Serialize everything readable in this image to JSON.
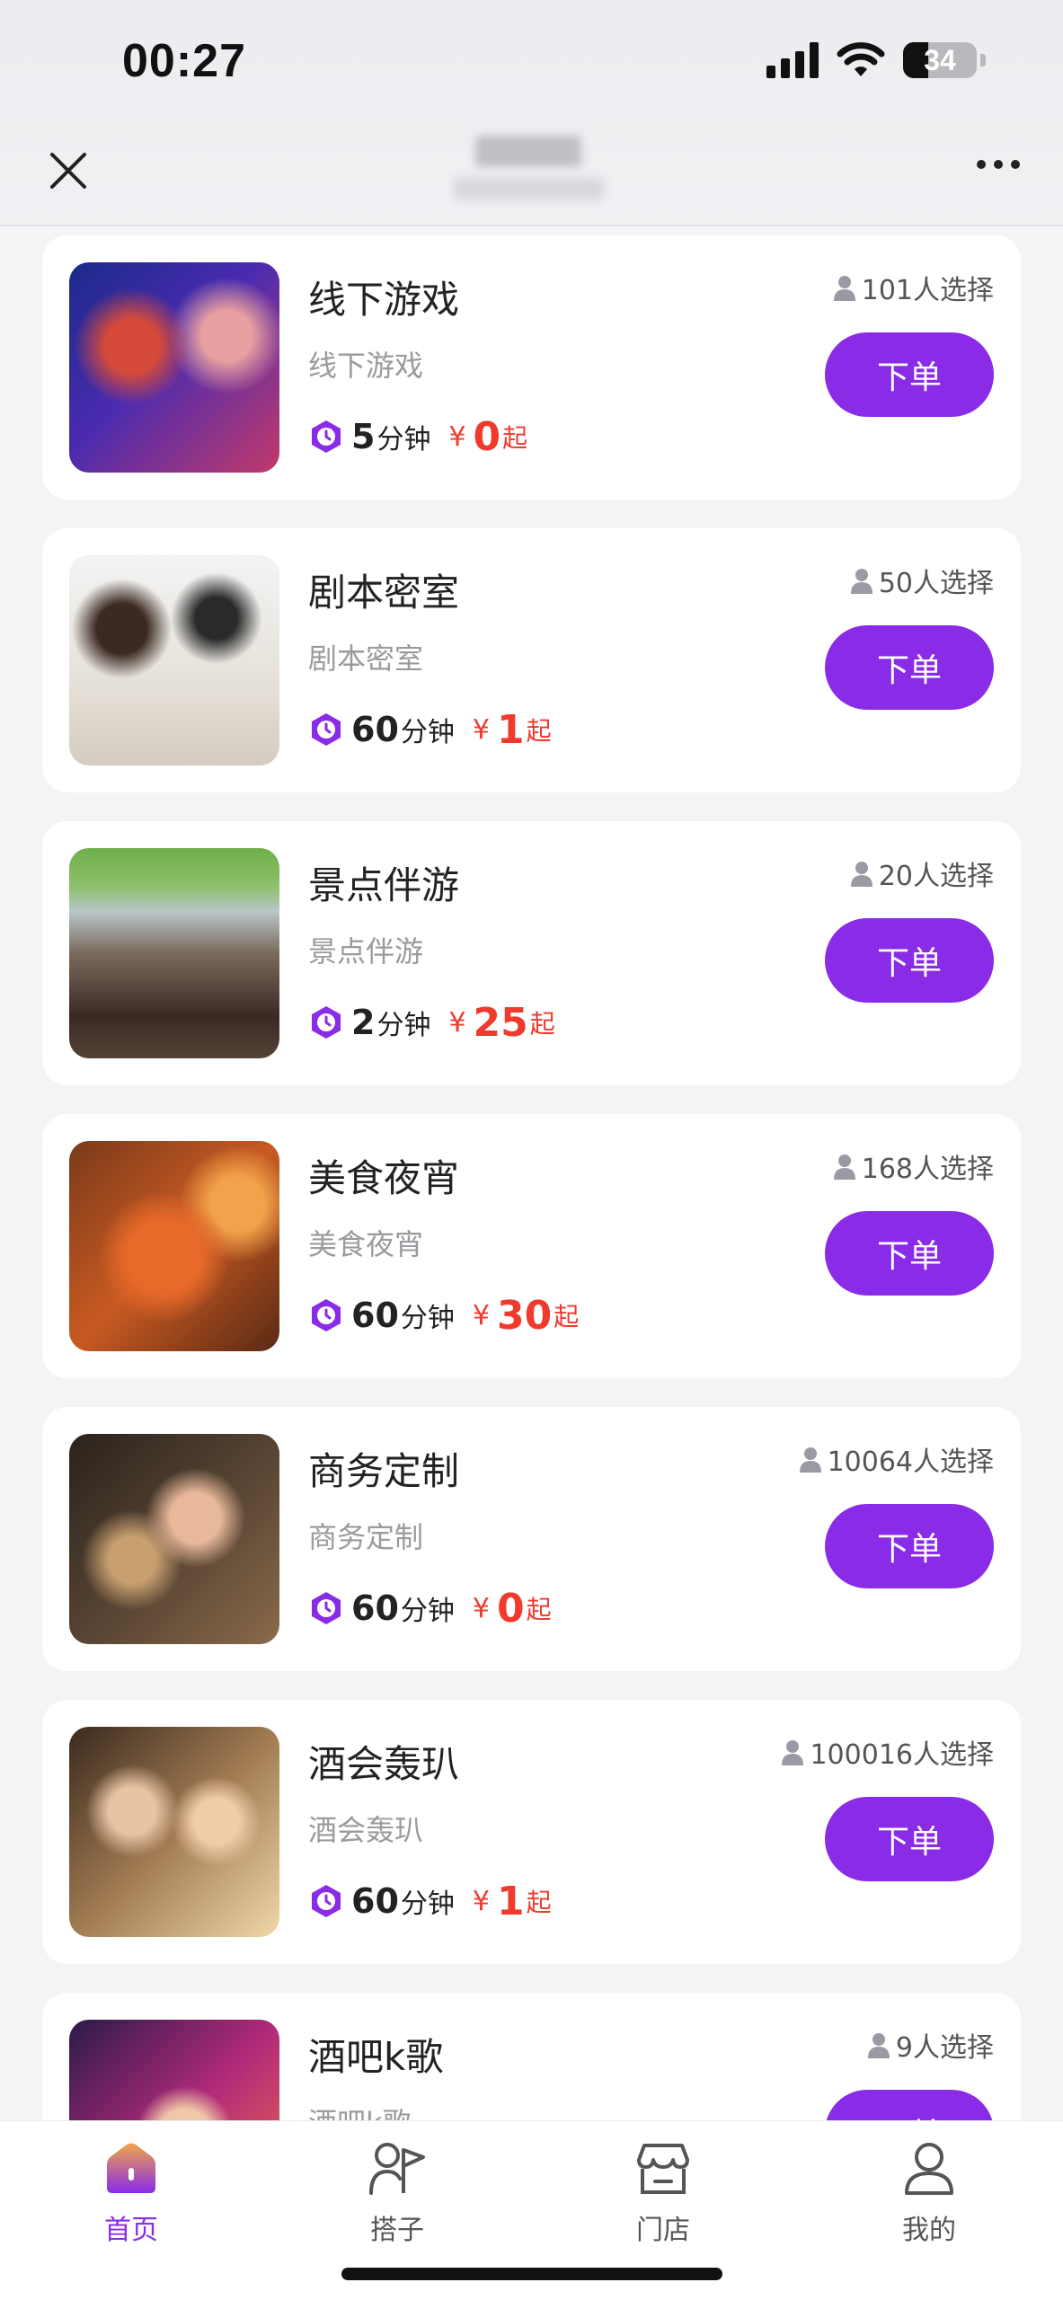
{
  "status_bar": {
    "time": "00:27",
    "battery": "34",
    "battery_level": 0.34
  },
  "header": {
    "close_icon": "close-icon",
    "more_icon": "more-icon"
  },
  "theme": {
    "accent": "#8a2be8",
    "price": "#f03a2e"
  },
  "items": [
    {
      "title": "线下游戏",
      "subtitle": "线下游戏",
      "duration": "5",
      "duration_unit": "分钟",
      "currency": "¥",
      "price": "0",
      "price_suffix": "起",
      "chosen": "101人选择",
      "button": "下单"
    },
    {
      "title": "剧本密室",
      "subtitle": "剧本密室",
      "duration": "60",
      "duration_unit": "分钟",
      "currency": "¥",
      "price": "1",
      "price_suffix": "起",
      "chosen": "50人选择",
      "button": "下单"
    },
    {
      "title": "景点伴游",
      "subtitle": "景点伴游",
      "duration": "2",
      "duration_unit": "分钟",
      "currency": "¥",
      "price": "25",
      "price_suffix": "起",
      "chosen": "20人选择",
      "button": "下单"
    },
    {
      "title": "美食夜宵",
      "subtitle": "美食夜宵",
      "duration": "60",
      "duration_unit": "分钟",
      "currency": "¥",
      "price": "30",
      "price_suffix": "起",
      "chosen": "168人选择",
      "button": "下单"
    },
    {
      "title": "商务定制",
      "subtitle": "商务定制",
      "duration": "60",
      "duration_unit": "分钟",
      "currency": "¥",
      "price": "0",
      "price_suffix": "起",
      "chosen": "10064人选择",
      "button": "下单"
    },
    {
      "title": "酒会轰玐",
      "subtitle": "酒会轰玐",
      "duration": "60",
      "duration_unit": "分钟",
      "currency": "¥",
      "price": "1",
      "price_suffix": "起",
      "chosen": "100016人选择",
      "button": "下单"
    },
    {
      "title": "酒吧k歌",
      "subtitle": "酒吧k歌",
      "duration": "",
      "duration_unit": "",
      "currency": "",
      "price": "",
      "price_suffix": "",
      "chosen": "9人选择",
      "button": "下单"
    }
  ],
  "tabs": [
    {
      "label": "首页",
      "icon": "home-icon",
      "active": true
    },
    {
      "label": "搭子",
      "icon": "partner-icon",
      "active": false
    },
    {
      "label": "门店",
      "icon": "store-icon",
      "active": false
    },
    {
      "label": "我的",
      "icon": "profile-icon",
      "active": false
    }
  ]
}
